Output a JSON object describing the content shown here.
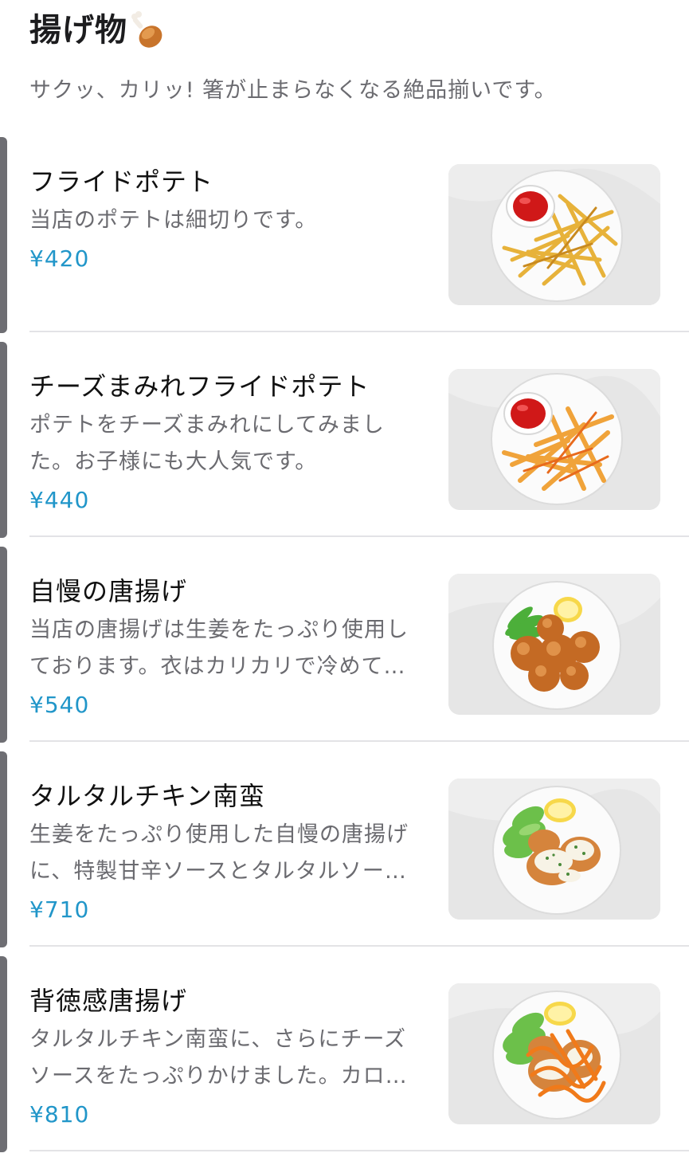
{
  "section": {
    "title": "揚げ物",
    "title_icon": "drumstick-icon",
    "description": "サクッ、カリッ! 箸が止まらなくなる絶品揃いです。"
  },
  "colors": {
    "price": "#2196c9",
    "accent_bar": "#6e6e73",
    "description": "#6b6b70"
  },
  "items": [
    {
      "name": "フライドポテト",
      "description": "当店のポテトは細切りです。",
      "price": "¥420",
      "photo": "fries-photo"
    },
    {
      "name": "チーズまみれフライドポテト",
      "description": "ポテトをチーズまみれにしてみました。お子様にも大人気です。",
      "price": "¥440",
      "photo": "cheese-fries-photo"
    },
    {
      "name": "自慢の唐揚げ",
      "description": "当店の唐揚げは生姜をたっぷり使用しております。衣はカリカリで冷めて…",
      "price": "¥540",
      "photo": "karaage-photo"
    },
    {
      "name": "タルタルチキン南蛮",
      "description": "生姜をたっぷり使用した自慢の唐揚げに、特製甘辛ソースとタルタルソー…",
      "price": "¥710",
      "photo": "chicken-nanban-photo"
    },
    {
      "name": "背徳感唐揚げ",
      "description": "タルタルチキン南蛮に、さらにチーズソースをたっぷりかけました。カロ…",
      "price": "¥810",
      "photo": "cheese-karaage-photo"
    }
  ]
}
